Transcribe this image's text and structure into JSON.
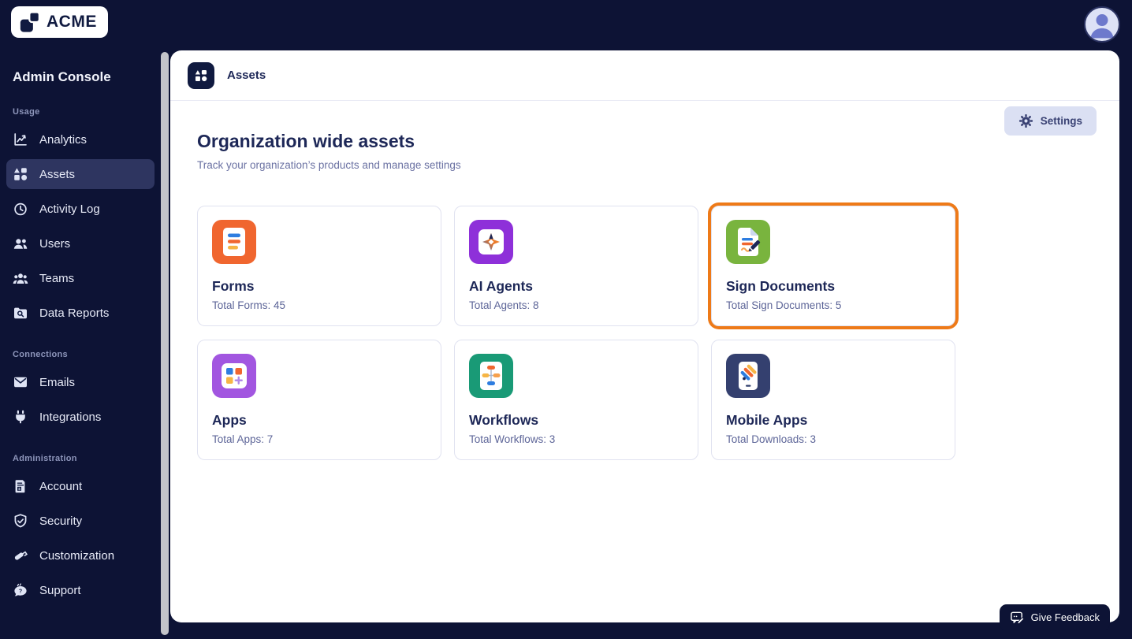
{
  "topbar": {
    "logo_text": "ACME"
  },
  "sidebar": {
    "title": "Admin Console",
    "sections": [
      {
        "label": "Usage",
        "items": [
          {
            "label": "Analytics",
            "icon": "analytics-icon",
            "active": false
          },
          {
            "label": "Assets",
            "icon": "assets-icon",
            "active": true
          },
          {
            "label": "Activity Log",
            "icon": "activity-log-icon",
            "active": false
          },
          {
            "label": "Users",
            "icon": "users-icon",
            "active": false
          },
          {
            "label": "Teams",
            "icon": "teams-icon",
            "active": false
          },
          {
            "label": "Data Reports",
            "icon": "data-reports-icon",
            "active": false
          }
        ]
      },
      {
        "label": "Connections",
        "items": [
          {
            "label": "Emails",
            "icon": "email-icon",
            "active": false
          },
          {
            "label": "Integrations",
            "icon": "plug-icon",
            "active": false
          }
        ]
      },
      {
        "label": "Administration",
        "items": [
          {
            "label": "Account",
            "icon": "invoice-icon",
            "active": false
          },
          {
            "label": "Security",
            "icon": "shield-icon",
            "active": false
          },
          {
            "label": "Customization",
            "icon": "paint-roller-icon",
            "active": false
          },
          {
            "label": "Support",
            "icon": "support-chat-icon",
            "active": false
          }
        ]
      }
    ]
  },
  "main": {
    "breadcrumb": "Assets",
    "title": "Organization wide assets",
    "subtitle": "Track your organization’s products and manage settings",
    "settings_button": "Settings",
    "cards": [
      {
        "title": "Forms",
        "stat": "Total Forms: 45",
        "icon": "forms-icon",
        "color": "#F0662F",
        "highlighted": false
      },
      {
        "title": "AI Agents",
        "stat": "Total Agents: 8",
        "icon": "ai-agents-icon",
        "color": "#8E30D9",
        "highlighted": false
      },
      {
        "title": "Sign Documents",
        "stat": "Total Sign Documents: 5",
        "icon": "sign-documents-icon",
        "color": "#79B43E",
        "highlighted": true
      },
      {
        "title": "Apps",
        "stat": "Total Apps: 7",
        "icon": "apps-icon",
        "color": "#A256E0",
        "highlighted": false
      },
      {
        "title": "Workflows",
        "stat": "Total Workflows: 3",
        "icon": "workflows-icon",
        "color": "#199A76",
        "highlighted": false
      },
      {
        "title": "Mobile Apps",
        "stat": "Total Downloads: 3",
        "icon": "mobile-apps-icon",
        "color": "#34406F",
        "highlighted": false
      }
    ]
  },
  "feedback_button": "Give Feedback",
  "colors": {
    "background_navy": "#0D1335",
    "active_nav_highlight": "#2E3560",
    "highlight_border_orange": "#EE7A18",
    "settings_button_bg": "#DBE0F3",
    "title_text": "#1D2757",
    "muted_text": "#6B72A3",
    "card_border": "#E0E2F0",
    "scrollbar_thumb": "#C3C4C9"
  }
}
